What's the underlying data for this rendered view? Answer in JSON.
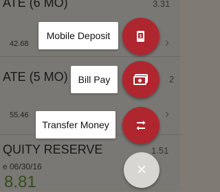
{
  "background": {
    "rows": [
      {
        "title": "ATE (6 MO)",
        "right": "3.31",
        "sub": "42.68"
      },
      {
        "title": "ATE (5 MO)",
        "right": "2",
        "sub": "55.46"
      },
      {
        "title": "QUITY RESERVE",
        "right": "1.51",
        "sub": "e 06/30/16",
        "amount": "8.81"
      }
    ]
  },
  "fab_menu": {
    "items": [
      {
        "label": "Mobile Deposit",
        "icon": "mobile-deposit-icon"
      },
      {
        "label": "Bill Pay",
        "icon": "bill-pay-icon"
      },
      {
        "label": "Transfer Money",
        "icon": "transfer-icon"
      }
    ],
    "close_glyph": "×"
  },
  "colors": {
    "fab_red": "#b0262e",
    "close_fab": "#d7d6d3",
    "amount_green": "#6a9a3c"
  }
}
